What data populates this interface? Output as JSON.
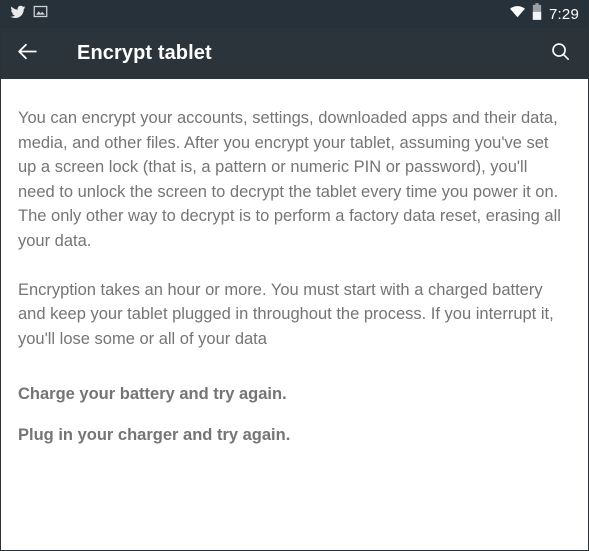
{
  "status_bar": {
    "icons_left": [
      {
        "name": "twitter-icon",
        "label": "Twitter notification"
      },
      {
        "name": "screenshot-icon",
        "label": "Screenshot captured"
      }
    ],
    "icons_right": [
      {
        "name": "wifi-icon",
        "label": "Wi-Fi connected"
      },
      {
        "name": "battery-icon",
        "label": "Battery"
      }
    ],
    "clock": "7:29",
    "background_color": "#27313a"
  },
  "action_bar": {
    "back_icon": "arrow-back-icon",
    "title": "Encrypt tablet",
    "search_icon": "search-icon",
    "background_color": "#2b343b",
    "title_color": "#ffffff"
  },
  "content": {
    "text_color": "#757575",
    "paragraphs": [
      "You can encrypt your accounts, settings, downloaded apps and their data, media, and other files. After you encrypt your tablet, assuming you've set up a screen lock (that is, a pattern or numeric PIN or password), you'll need to unlock the screen to decrypt the tablet every time you power it on. The only other way to decrypt is to perform a factory data reset, erasing all your data.",
      "Encryption takes an hour or more. You must start with a charged battery and keep your tablet plugged in throughout the process. If you interrupt it, you'll lose some or all of your data"
    ],
    "notices": [
      "Charge your battery and try again.",
      "Plug in your charger and try again."
    ]
  }
}
